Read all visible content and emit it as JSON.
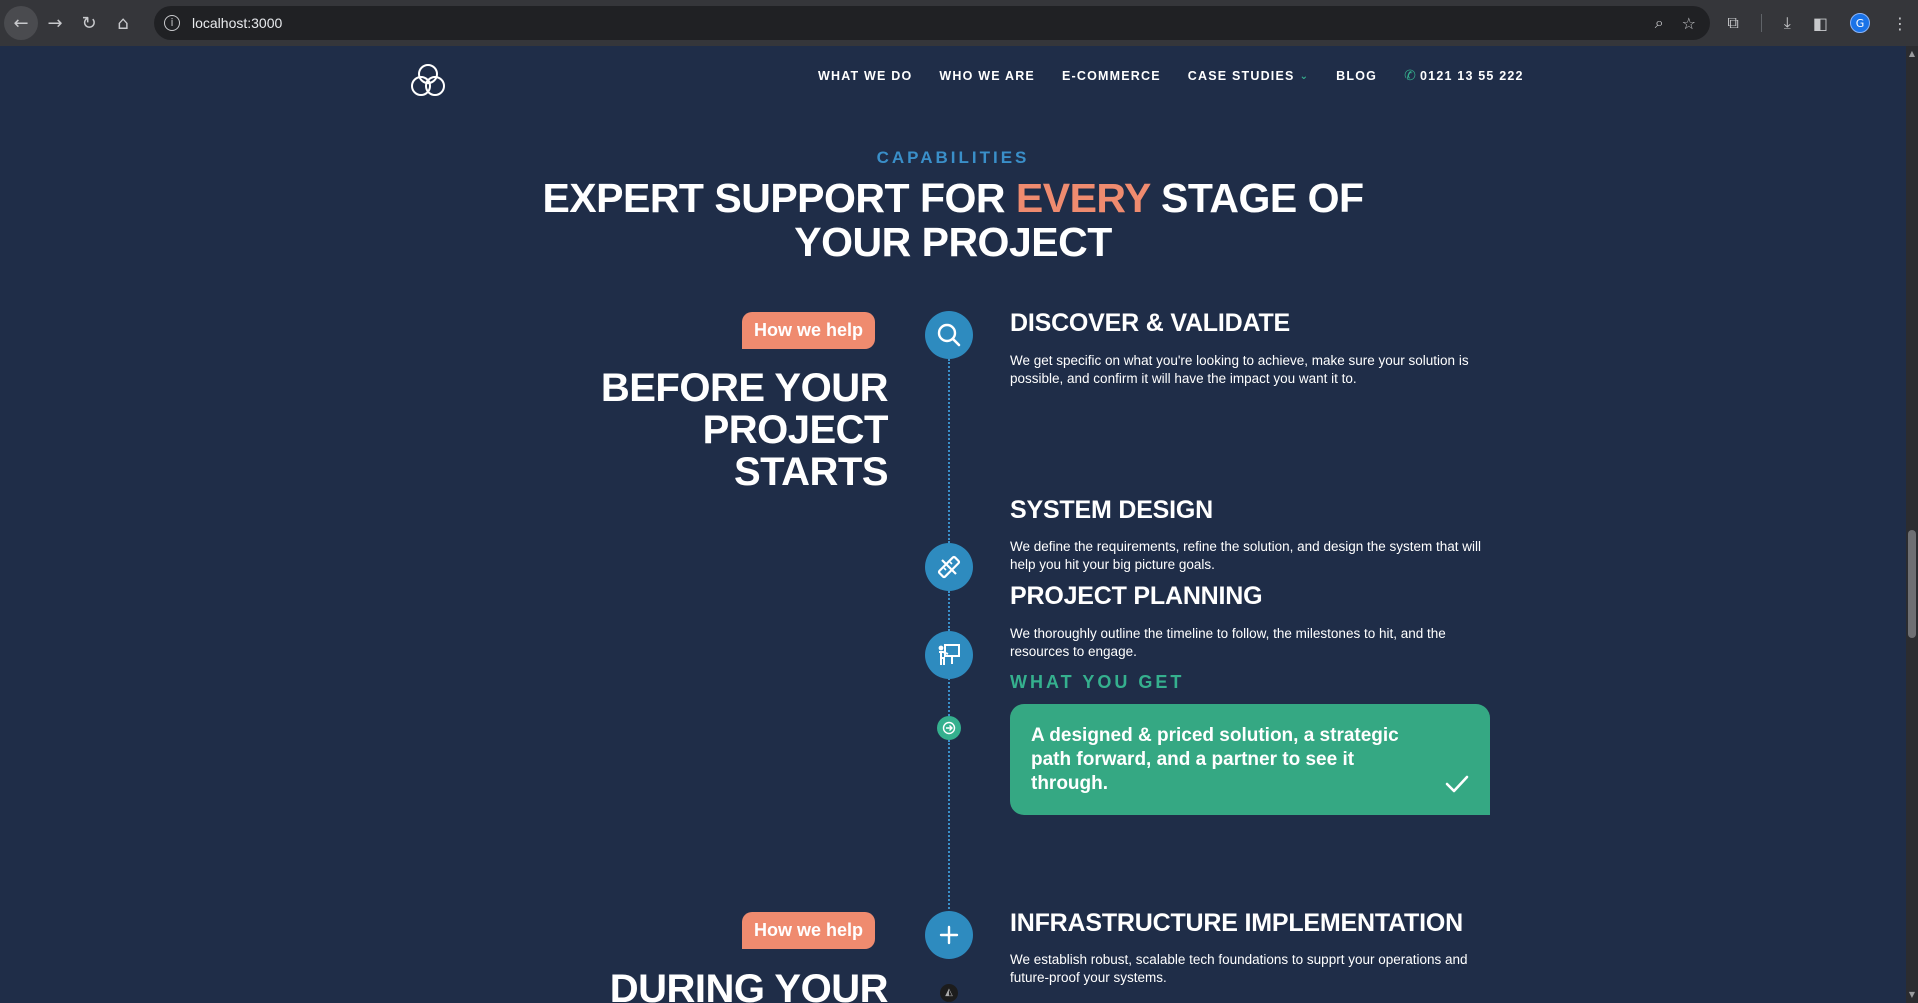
{
  "browser": {
    "url": "localhost:3000",
    "avatar_letter": "G"
  },
  "header": {
    "nav": [
      {
        "label": "WHAT WE DO"
      },
      {
        "label": "WHO WE ARE"
      },
      {
        "label": "E-COMMERCE"
      },
      {
        "label": "CASE STUDIES"
      },
      {
        "label": "BLOG"
      }
    ],
    "phone": "0121 13 55 222"
  },
  "capabilities": {
    "eyebrow": "CAPABILITIES",
    "headline_part1": "EXPERT SUPPORT FOR ",
    "headline_accent": "EVERY",
    "headline_part2": " STAGE OF",
    "headline_line2": "YOUR PROJECT"
  },
  "before": {
    "pill": "How we help",
    "title_line1": "BEFORE YOUR",
    "title_line2": "PROJECT",
    "title_line3": "STARTS",
    "steps": [
      {
        "title": "DISCOVER & VALIDATE",
        "desc": "We get specific on what you're looking to achieve, make sure your solution is possible, and confirm it will have the impact you want it to.",
        "icon": "search-icon"
      },
      {
        "title": "SYSTEM DESIGN",
        "desc": "We define the requirements, refine the solution, and design the system that will help you hit your big picture goals.",
        "icon": "ruler-pencil-icon"
      },
      {
        "title": "PROJECT PLANNING",
        "desc": "We thoroughly outline the timeline to follow, the milestones to hit, and the resources to engage.",
        "icon": "presentation-icon"
      }
    ],
    "what_you_get_label": "WHAT YOU GET",
    "what_you_get": "A designed & priced solution, a strategic path forward, and a partner to see it through."
  },
  "during": {
    "pill": "How we help",
    "title_line1": "DURING YOUR",
    "steps": [
      {
        "title": "INFRASTRUCTURE IMPLEMENTATION",
        "desc": "We establish robust, scalable tech foundations to supprt your operations and future-proof your systems.",
        "icon": "plus-icon"
      }
    ]
  },
  "colors": {
    "background": "#1f2d48",
    "accent_coral": "#ef8b6f",
    "accent_blue": "#2e8bbf",
    "accent_green": "#35a883"
  }
}
